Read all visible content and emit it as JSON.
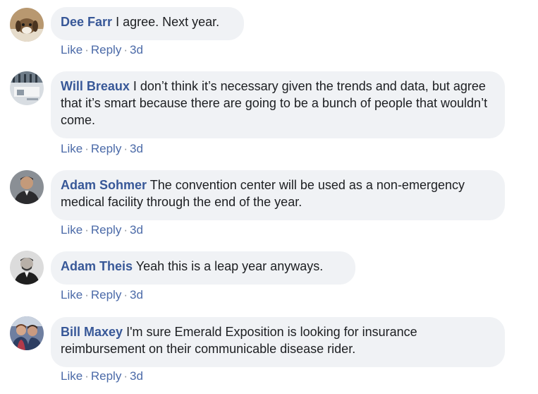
{
  "comments": [
    {
      "author": "Dee Farr",
      "text": "I agree. Next year.",
      "like": "Like",
      "reply": "Reply",
      "time": "3d",
      "sep": "·",
      "avatar_icon": "dog-avatar"
    },
    {
      "author": "Will Breaux",
      "text": "I don’t think it’s necessary given the trends and data, but agree that it’s smart because there are going to be a bunch of people that wouldn’t come.",
      "like": "Like",
      "reply": "Reply",
      "time": "3d",
      "sep": "·",
      "avatar_icon": "office-avatar"
    },
    {
      "author": "Adam Sohmer",
      "text": "The convention center will be used as a non-emergency medical facility through the end of the year.",
      "like": "Like",
      "reply": "Reply",
      "time": "3d",
      "sep": "·",
      "avatar_icon": "man-dark-avatar"
    },
    {
      "author": "Adam Theis",
      "text": "Yeah this is a leap year anyways.",
      "like": "Like",
      "reply": "Reply",
      "time": "3d",
      "sep": "·",
      "avatar_icon": "man-gray-avatar"
    },
    {
      "author": "Bill Maxey",
      "text": "I'm sure Emerald Exposition is looking for insurance reimbursement on their communicable disease rider.",
      "like": "Like",
      "reply": "Reply",
      "time": "3d",
      "sep": "·",
      "avatar_icon": "group-avatar"
    }
  ],
  "colors": {
    "author": "#385898",
    "bubble": "#f0f2f5",
    "text": "#1c1e21",
    "action": "#4b6aa8"
  }
}
